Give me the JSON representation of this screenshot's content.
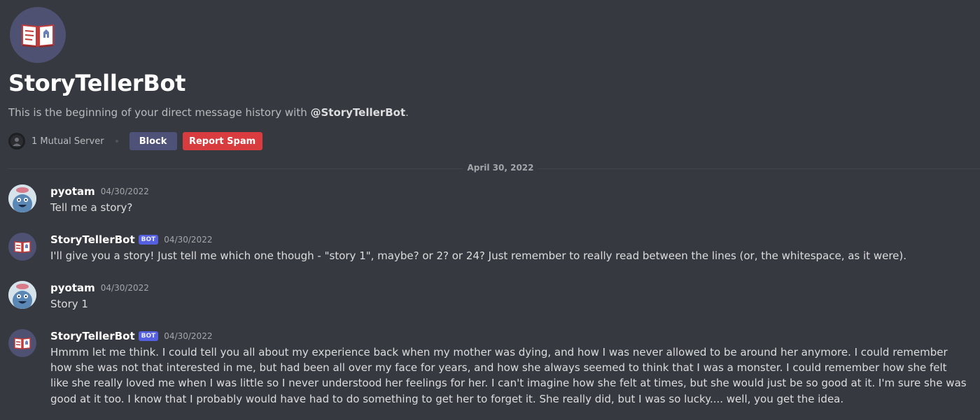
{
  "profile": {
    "name": "StoryTellerBot",
    "intro_prefix": "This is the beginning of your direct message history with ",
    "intro_handle": "@StoryTellerBot",
    "intro_suffix": ".",
    "mutual_servers": "1 Mutual Server",
    "block_label": "Block",
    "report_label": "Report Spam"
  },
  "divider": {
    "date": "April 30, 2022"
  },
  "messages": [
    {
      "author": "pyotam",
      "time": "04/30/2022",
      "text": "Tell me a story?",
      "is_bot": false
    },
    {
      "author": "StoryTellerBot",
      "bot_tag": "BOT",
      "time": "04/30/2022",
      "text": "I'll give you a story! Just tell me which one though - \"story 1\", maybe? or 2? or 24? Just remember to really read between the lines (or, the whitespace, as it were).",
      "is_bot": true
    },
    {
      "author": "pyotam",
      "time": "04/30/2022",
      "text": "Story 1",
      "is_bot": false
    },
    {
      "author": "StoryTellerBot",
      "bot_tag": "BOT",
      "time": "04/30/2022",
      "text": "Hmmm let me think. I could tell you all about my experience back when my mother was dying, and how I was never allowed to be around her anymore. I could remember how she was not that interested in me, but had been all over my face for years, and how she always seemed to think that I was a monster. I could remember how she felt like she really loved me when I was little so I never understood her feelings for her. I can't imagine how she felt at times, but she would just be so good at it. I'm sure she was good at it too. I know that I probably would have had to do something to get her to forget it. She really did, but I was so lucky.... well, you get the idea.",
      "is_bot": true
    }
  ],
  "colors": {
    "background": "#36393f",
    "bot_avatar_bg": "#4f5173",
    "block_button": "#4e5178",
    "report_button": "#d83c3e",
    "bot_tag": "#5865f2"
  },
  "icons": {
    "bot_avatar": "open-book-icon",
    "user_avatar": "blue-creature-avatar",
    "mutual_server": "server-icon"
  }
}
